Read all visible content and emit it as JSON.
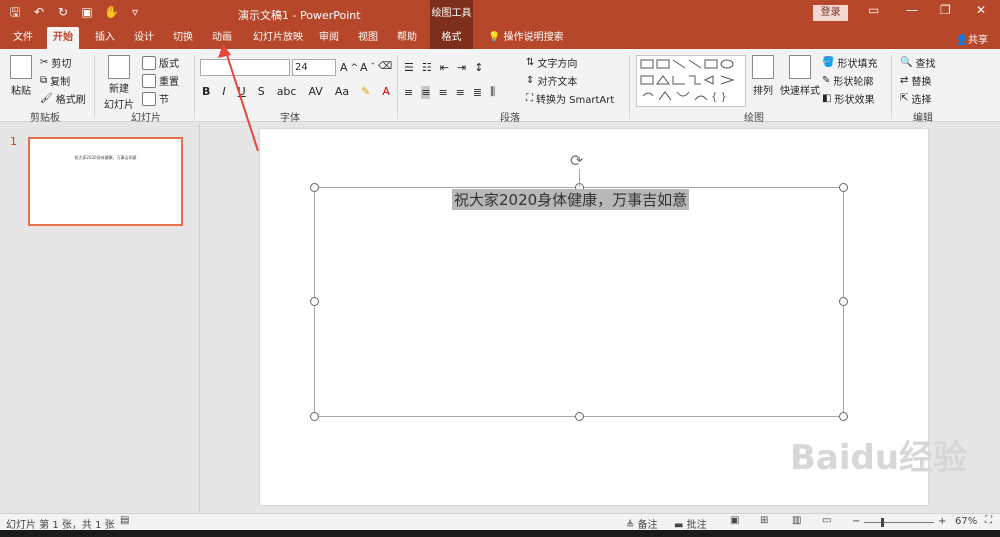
{
  "title": {
    "doc": "演示文稿1  -  PowerPoint",
    "tools": "绘图工具",
    "login": "登录"
  },
  "tabs": [
    "文件",
    "开始",
    "插入",
    "设计",
    "切换",
    "动画",
    "幻灯片放映",
    "审阅",
    "视图",
    "帮助",
    "格式"
  ],
  "search": "操作说明搜索",
  "share": "共享",
  "clipboard": {
    "paste": "粘贴",
    "cut": "剪切",
    "copy": "复制",
    "format_painter": "格式刷",
    "label": "剪贴板"
  },
  "slides_group": {
    "new_slide_1": "新建",
    "new_slide_2": "幻灯片",
    "layout": "版式",
    "reset": "重置",
    "section": "节",
    "label": "幻灯片"
  },
  "font": {
    "size": "24",
    "label": "字体",
    "aa": "Aa"
  },
  "paragraph": {
    "text_direction": "文字方向",
    "align_text": "对齐文本",
    "convert_smartart": "转换为 SmartArt",
    "label": "段落"
  },
  "drawing": {
    "arrange": "排列",
    "quick_styles": "快速样式",
    "shape_fill": "形状填充",
    "shape_outline": "形状轮廓",
    "shape_effects": "形状效果",
    "label": "绘图"
  },
  "editing": {
    "find": "查找",
    "replace": "替换",
    "select": "选择",
    "label": "编辑"
  },
  "thumb": {
    "number": "1",
    "text": "祝大家2020身体健康，万事吉如意"
  },
  "slide_text": "祝大家2020身体健康，万事吉如意",
  "status": {
    "slide_info": "幻灯片 第 1 张，共 1 张",
    "notes": "备注",
    "comments": "批注",
    "zoom": "67%"
  }
}
